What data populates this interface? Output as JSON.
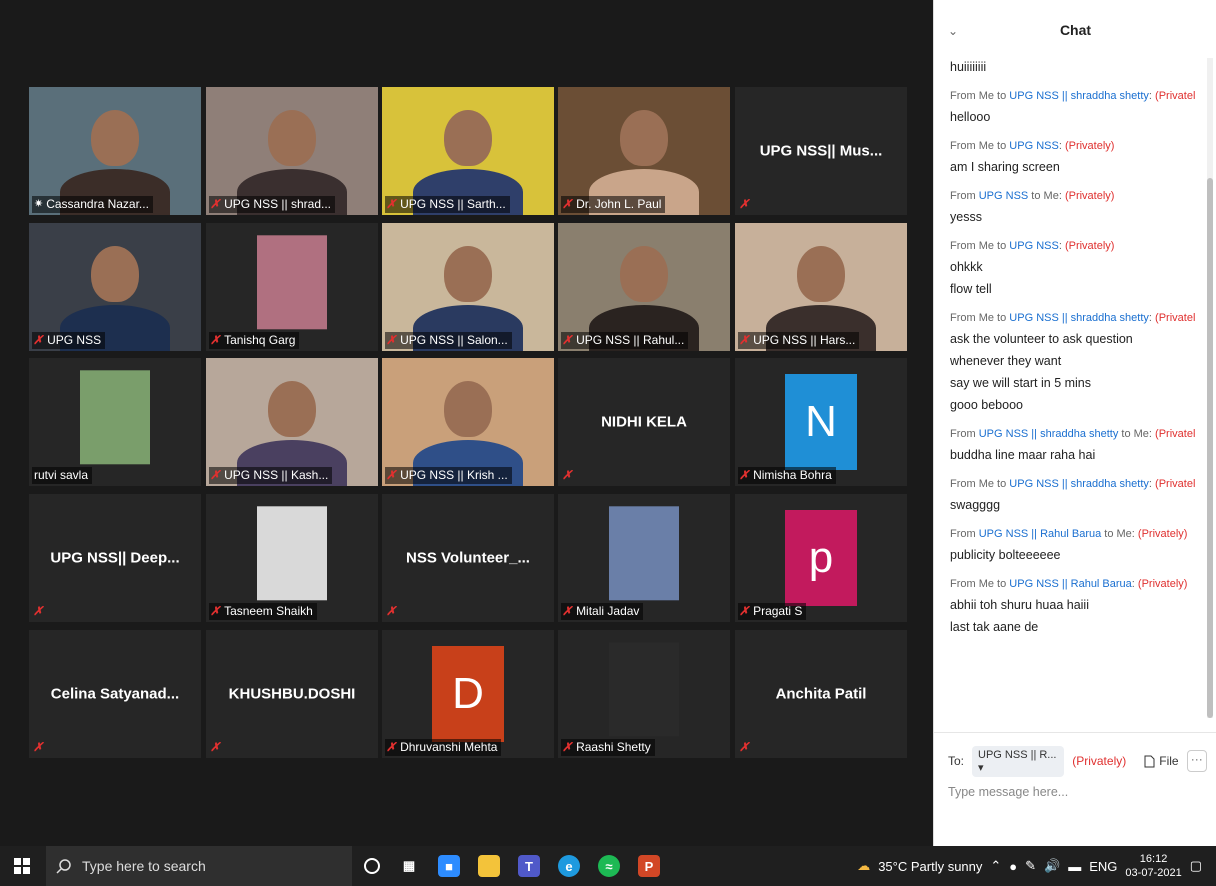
{
  "gallery": {
    "tiles": [
      {
        "label": "Cassandra Nazar...",
        "big": "",
        "kind": "video",
        "bg": "#5a6f7a",
        "fg": "#3b2d28",
        "pinned": true
      },
      {
        "label": "UPG NSS || shrad...",
        "big": "",
        "kind": "video",
        "bg": "#8f7f78",
        "fg": "#3a2f2f"
      },
      {
        "label": "UPG NSS || Sarth...",
        "big": "",
        "kind": "video",
        "bg": "#d8c23a",
        "fg": "#2f3f6a"
      },
      {
        "label": "Dr. John L. Paul",
        "big": "",
        "kind": "video",
        "bg": "#6b4e35",
        "fg": "#c9a58a"
      },
      {
        "label": "",
        "big": "UPG NSS|| Mus...",
        "kind": "name"
      },
      {
        "label": "UPG NSS",
        "big": "",
        "kind": "video",
        "bg": "#3a3f48",
        "fg": "#1d2f4f"
      },
      {
        "label": "Tanishq Garg",
        "big": "",
        "kind": "photo",
        "bg": "#2a2a2a",
        "fg": "#b07080"
      },
      {
        "label": "UPG NSS || Salon...",
        "big": "",
        "kind": "video",
        "bg": "#c9b79b",
        "fg": "#2a3a60"
      },
      {
        "label": "UPG NSS || Rahul...",
        "big": "",
        "kind": "video",
        "bg": "#8a7f6e",
        "fg": "#2a2320"
      },
      {
        "label": "UPG NSS || Hars...",
        "big": "",
        "kind": "video",
        "bg": "#c7b09a",
        "fg": "#3a2f2c"
      },
      {
        "label": "rutvi savla",
        "big": "",
        "kind": "photo",
        "bg": "#262626",
        "fg": "#7a9e6b"
      },
      {
        "label": "UPG NSS || Kash...",
        "big": "",
        "kind": "video",
        "bg": "#b7a79a",
        "fg": "#4a4060"
      },
      {
        "label": "UPG NSS || Krish ...",
        "big": "",
        "kind": "video",
        "bg": "#c9a07a",
        "fg": "#2f4f88"
      },
      {
        "label": "",
        "big": "NIDHI KELA",
        "kind": "name"
      },
      {
        "label": "Nimisha Bohra",
        "big": "N",
        "kind": "letter",
        "bg": "#1f8fd6"
      },
      {
        "label": "",
        "big": "UPG NSS|| Deep...",
        "kind": "name"
      },
      {
        "label": "Tasneem Shaikh",
        "big": "",
        "kind": "photo",
        "bg": "#262626",
        "fg": "#d9d9d9"
      },
      {
        "label": "",
        "big": "NSS Volunteer_...",
        "kind": "name"
      },
      {
        "label": "Mitali Jadav",
        "big": "",
        "kind": "photo",
        "bg": "#262626",
        "fg": "#6a7fa8"
      },
      {
        "label": "Pragati S",
        "big": "p",
        "kind": "letter",
        "bg": "#c21a5d"
      },
      {
        "label": "",
        "big": "Celina  Satyanad...",
        "kind": "name"
      },
      {
        "label": "",
        "big": "KHUSHBU.DOSHI",
        "kind": "name"
      },
      {
        "label": "Dhruvanshi Mehta",
        "big": "D",
        "kind": "letter",
        "bg": "#c8401a"
      },
      {
        "label": "Raashi Shetty",
        "big": "",
        "kind": "photo",
        "bg": "#262626",
        "fg": "#2a2a2a"
      },
      {
        "label": "",
        "big": "Anchita Patil",
        "kind": "name"
      }
    ]
  },
  "chat": {
    "title": "Chat",
    "first_line": "huiiiiiiii",
    "messages": [
      {
        "prefix": "From Me to ",
        "who": "UPG NSS || shraddha shetty",
        "suffix": ": ",
        "priv": "(Privately)",
        "lines": [
          "hellooo"
        ]
      },
      {
        "prefix": "From Me to ",
        "who": "UPG NSS",
        "suffix": ": ",
        "priv": "(Privately)",
        "lines": [
          "am I sharing screen"
        ]
      },
      {
        "prefix": "From ",
        "who": "UPG NSS",
        "suffix": " to Me: ",
        "priv": "(Privately)",
        "lines": [
          "yesss"
        ]
      },
      {
        "prefix": "From Me to ",
        "who": "UPG NSS",
        "suffix": ": ",
        "priv": "(Privately)",
        "lines": [
          "ohkkk",
          "flow tell"
        ]
      },
      {
        "prefix": "From Me to ",
        "who": "UPG NSS || shraddha shetty",
        "suffix": ": ",
        "priv": "(Privately)",
        "lines": [
          "ask the volunteer to ask question",
          "whenever they want",
          "say we will start in 5 mins",
          "gooo bebooo"
        ]
      },
      {
        "prefix": "From ",
        "who": "UPG NSS || shraddha shetty",
        "suffix": " to Me: ",
        "priv": "(Privately)",
        "lines": [
          "buddha line maar raha hai"
        ]
      },
      {
        "prefix": "From Me to ",
        "who": "UPG NSS || shraddha shetty",
        "suffix": ": ",
        "priv": "(Privately)",
        "lines": [
          "swagggg"
        ]
      },
      {
        "prefix": "From ",
        "who": "UPG NSS || Rahul Barua",
        "suffix": " to Me: ",
        "priv": "(Privately)",
        "lines": [
          "publicity bolteeeeee"
        ]
      },
      {
        "prefix": "From Me to ",
        "who": "UPG NSS || Rahul Barua",
        "suffix": ": ",
        "priv": "(Privately)",
        "lines": [
          "abhii toh shuru huaa haiii",
          "last tak aane de"
        ]
      }
    ],
    "compose": {
      "to_label": "To:",
      "to_value": "UPG NSS || R...",
      "privately": "(Privately)",
      "file_label": "File",
      "more_label": "···",
      "placeholder": "Type message here..."
    }
  },
  "taskbar": {
    "search_placeholder": "Type here to search",
    "weather": "35°C  Partly sunny",
    "lang": "ENG",
    "time": "16:12",
    "date": "03-07-2021"
  }
}
